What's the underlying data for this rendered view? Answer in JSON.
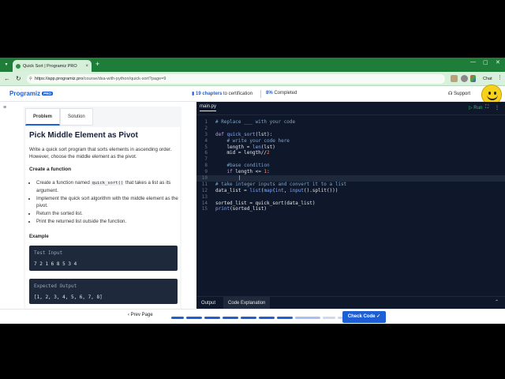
{
  "browser": {
    "tab_title": "Quick Sort | Programiz PRO",
    "url_host": "https://app.programiz.pro",
    "url_path": "/course/dsa-with-python/quick-sort?page=9",
    "chat_label": "Chat"
  },
  "header": {
    "logo": "Programiz",
    "logo_badge": "PRO",
    "chapters_count": "19 chapters",
    "chapters_suffix": " to certification",
    "completed_pct": "8%",
    "completed_suffix": " Completed",
    "support_label": "Support"
  },
  "problem": {
    "tabs": [
      "Problem",
      "Solution"
    ],
    "title": "Pick Middle Element as Pivot",
    "description": "Write a quick sort program that sorts elements in ascending order. However, choose the middle element as the pivot.",
    "create_heading": "Create a function",
    "bullet1_pre": "Create a function named ",
    "bullet1_code": "quick_sort()",
    "bullet1_post": " that takes a list as its argument.",
    "bullet2": "Implement the quick sort algorithm with the middle element as the pivot.",
    "bullet3": "Return the sorted list.",
    "bullet4": "Print the returned list outside the function.",
    "example_heading": "Example",
    "test_input_label": "Test Input",
    "test_input_value": "7 2 1 6 8 5 3 4",
    "expected_output_label": "Expected Output",
    "expected_output_value": "[1, 2, 3, 4, 5, 6, 7, 8]"
  },
  "editor": {
    "file_tab": "main.py",
    "run_label": "Run",
    "footer_tabs": [
      "Output",
      "Code Explanation"
    ]
  },
  "bottom": {
    "prev_label": "Prev Page",
    "check_label": "Check Code",
    "progress_segments_done": 7,
    "progress_segments_total": 10
  }
}
